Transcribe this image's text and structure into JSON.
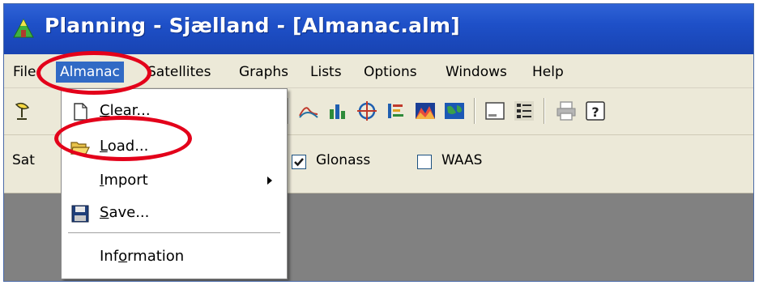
{
  "window": {
    "title": "Planning - Sjælland - [Almanac.alm]"
  },
  "menubar": {
    "items": [
      {
        "label": "File",
        "active": false
      },
      {
        "label": "Almanac",
        "active": true
      },
      {
        "label": "Satellites",
        "active": false
      },
      {
        "label": "Graphs",
        "active": false
      },
      {
        "label": "Lists",
        "active": false
      },
      {
        "label": "Options",
        "active": false
      },
      {
        "label": "Windows",
        "active": false
      },
      {
        "label": "Help",
        "active": false
      }
    ]
  },
  "toolbar": {
    "icons": [
      "satellite-dish-icon",
      "skyplot-icon",
      "elevation-graph-icon",
      "bar-chart-icon",
      "crosshair-icon",
      "list-graph-icon",
      "mountain-graph-icon",
      "world-map-icon",
      "window-icon",
      "list-view-icon",
      "printer-icon",
      "help-icon"
    ]
  },
  "filterbar": {
    "sat_label": "Sat",
    "glonass": {
      "label": "Glonass",
      "checked": true
    },
    "waas": {
      "label": "WAAS",
      "checked": false
    }
  },
  "dropdown": {
    "items": [
      {
        "pre": "",
        "accel": "C",
        "post": "lear...",
        "icon": "new-file-icon"
      },
      {
        "pre": "",
        "accel": "L",
        "post": "oad...",
        "icon": "open-folder-icon"
      },
      {
        "pre": "",
        "accel": "I",
        "post": "mport",
        "icon": "",
        "submenu": true
      },
      {
        "pre": "",
        "accel": "S",
        "post": "ave...",
        "icon": "floppy-disk-icon"
      },
      {
        "pre": "Inf",
        "accel": "o",
        "post": "rmation",
        "icon": ""
      }
    ]
  },
  "colors": {
    "titlebar": "#1e50c8",
    "menu_highlight": "#316ac5",
    "face": "#ece9d8",
    "workspace": "#818181",
    "annotation": "#e3001a"
  }
}
